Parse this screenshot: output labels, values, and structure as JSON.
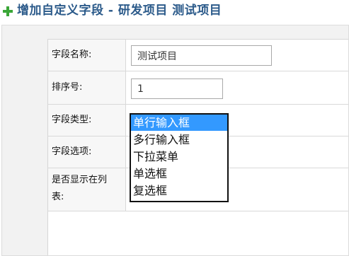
{
  "header": {
    "title": "增加自定义字段 - 研发项目 测试项目",
    "icon": "plus-icon",
    "title_color": "#2b5a8a"
  },
  "form": {
    "field_name_label": "字段名称:",
    "field_name_value": "测试项目",
    "order_label": "排序号:",
    "order_value": "1",
    "type_label": "字段类型:",
    "type_options": [
      "单行输入框",
      "多行输入框",
      "下拉菜单",
      "单选框",
      "复选框"
    ],
    "type_selected_index": 0,
    "options_label": "字段选项:",
    "show_in_list_label_line1": "是否显示在列",
    "show_in_list_label_line2": "表:"
  },
  "colors": {
    "selected_option_bg": "#3399ff"
  }
}
